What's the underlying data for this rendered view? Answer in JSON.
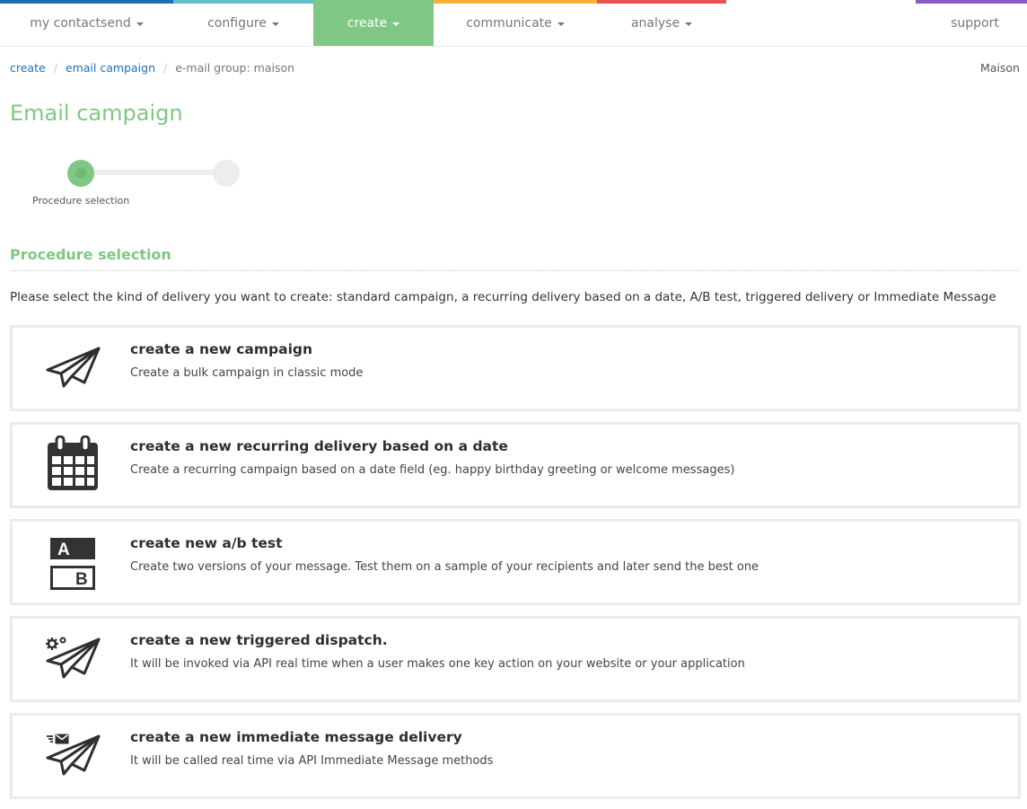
{
  "nav": {
    "items": [
      {
        "label": "my contactsend",
        "has_caret": true,
        "active": false,
        "color": "#1d70b8"
      },
      {
        "label": "configure",
        "has_caret": true,
        "active": false,
        "color": "#62c0cc"
      },
      {
        "label": "create",
        "has_caret": true,
        "active": true,
        "color": "#80c783"
      },
      {
        "label": "communicate",
        "has_caret": true,
        "active": false,
        "color": "#f6b13a"
      },
      {
        "label": "analyse",
        "has_caret": true,
        "active": false,
        "color": "#e8524f"
      },
      {
        "label": "support",
        "has_caret": false,
        "active": false,
        "color": "#8a5bc4"
      }
    ]
  },
  "breadcrumb": {
    "items": [
      {
        "label": "create",
        "link": true
      },
      {
        "label": "email campaign",
        "link": true
      },
      {
        "label": "e-mail group: maison",
        "link": false
      }
    ]
  },
  "account_name": "Maison",
  "page_title": "Email campaign",
  "stepper": {
    "steps": [
      {
        "label": "Procedure selection",
        "state": "current"
      },
      {
        "label": "",
        "state": "pending"
      }
    ]
  },
  "section": {
    "title": "Procedure selection",
    "intro": "Please select the kind of delivery you want to create: standard campaign, a recurring delivery based on a date, A/B test, triggered delivery or Immediate Message"
  },
  "options": [
    {
      "icon": "paper-plane-icon",
      "title": "create a new campaign",
      "description": "Create a bulk campaign in classic mode"
    },
    {
      "icon": "calendar-icon",
      "title": "create a new recurring delivery based on a date",
      "description": "Create a recurring campaign based on a date field (eg. happy birthday greeting or welcome messages)"
    },
    {
      "icon": "ab-test-icon",
      "title": "create new a/b test",
      "description": "Create two versions of your message. Test them on a sample of your recipients and later send the best one"
    },
    {
      "icon": "paper-plane-gears-icon",
      "title": "create a new triggered dispatch.",
      "description": "It will be invoked via API real time when a user makes one key action on your website or your application"
    },
    {
      "icon": "paper-plane-envelope-icon",
      "title": "create a new immediate message delivery",
      "description": "It will be called real time via API Immediate Message methods"
    }
  ],
  "ab_icon": {
    "a": "A",
    "b": "B"
  }
}
